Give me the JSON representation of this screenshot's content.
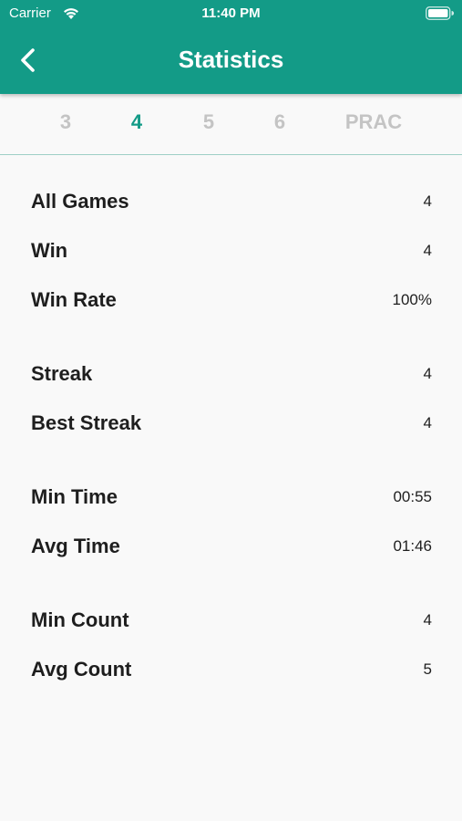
{
  "status_bar": {
    "carrier": "Carrier",
    "time": "11:40 PM"
  },
  "header": {
    "title": "Statistics",
    "back_icon": "chevron-left-icon",
    "background_color": "#139b87"
  },
  "tabs": {
    "items": [
      {
        "label": "3",
        "active": false
      },
      {
        "label": "4",
        "active": true
      },
      {
        "label": "5",
        "active": false
      },
      {
        "label": "6",
        "active": false
      },
      {
        "label": "PRAC",
        "active": false
      }
    ],
    "active_color": "#139b87",
    "inactive_color": "#c4c4c4"
  },
  "stats": {
    "groups": [
      [
        {
          "label": "All Games",
          "value": "4"
        },
        {
          "label": "Win",
          "value": "4"
        },
        {
          "label": "Win Rate",
          "value": "100%"
        }
      ],
      [
        {
          "label": "Streak",
          "value": "4"
        },
        {
          "label": "Best Streak",
          "value": "4"
        }
      ],
      [
        {
          "label": "Min Time",
          "value": "00:55"
        },
        {
          "label": "Avg Time",
          "value": "01:46"
        }
      ],
      [
        {
          "label": "Min Count",
          "value": "4"
        },
        {
          "label": "Avg Count",
          "value": "5"
        }
      ]
    ]
  }
}
